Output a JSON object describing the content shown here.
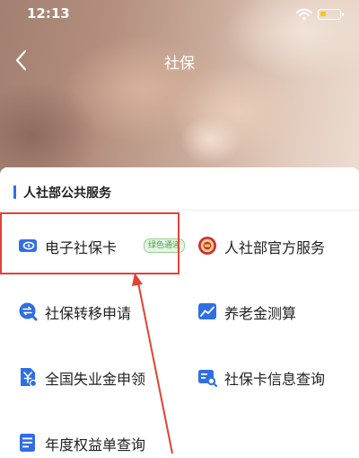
{
  "status_bar": {
    "time": "12:13"
  },
  "header": {
    "title": "社保"
  },
  "section": {
    "title": "人社部公共服务"
  },
  "services": [
    {
      "label": "电子社保卡",
      "badge": "绿色通道",
      "icon": "card-icon"
    },
    {
      "label": "人社部官方服务",
      "icon": "emblem-icon"
    },
    {
      "label": "社保转移申请",
      "icon": "transfer-icon"
    },
    {
      "label": "养老金测算",
      "icon": "chart-icon"
    },
    {
      "label": "全国失业金申领",
      "icon": "document-yuan-icon"
    },
    {
      "label": "社保卡信息查询",
      "icon": "card-search-icon"
    },
    {
      "label": "年度权益单查询",
      "icon": "document-list-icon"
    }
  ],
  "colors": {
    "accent": "#2f6fe4",
    "highlight": "#e04336",
    "badge": "#48a24e"
  }
}
